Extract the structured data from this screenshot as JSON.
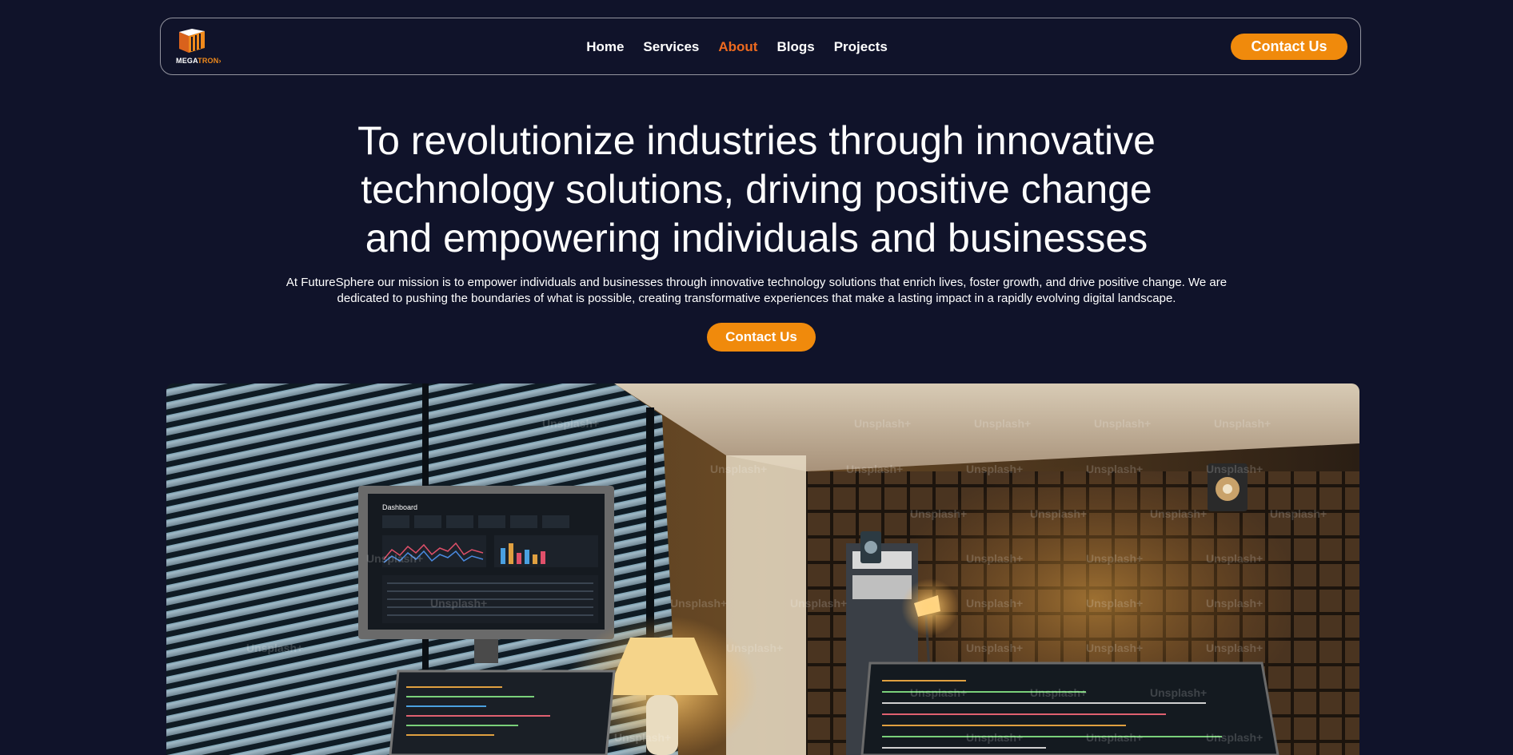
{
  "brand": {
    "logo_text_main": "MEGA",
    "logo_text_accent": "TRON",
    "logo_arrow": "›",
    "icon": "megatron-logo-icon"
  },
  "nav": {
    "items": [
      {
        "label": "Home",
        "active": false
      },
      {
        "label": "Services",
        "active": false
      },
      {
        "label": "About",
        "active": true
      },
      {
        "label": "Blogs",
        "active": false
      },
      {
        "label": "Projects",
        "active": false
      }
    ],
    "contact_label": "Contact Us"
  },
  "hero": {
    "title_line1": "To revolutionize industries through innovative",
    "title_line2": "technology solutions, driving positive change",
    "title_line3": "and empowering individuals and businesses",
    "subtitle_line1": "At FutureSphere our mission is to empower individuals and businesses through innovative technology solutions that enrich lives, foster growth, and drive positive change. We are",
    "subtitle_line2": "dedicated to pushing the boundaries of what is possible, creating transformative experiences that make a lasting impact in a rapidly evolving digital landscape.",
    "contact_label": "Contact Us"
  },
  "image": {
    "watermark": "Unsplash+",
    "monitor_title": "Dashboard"
  },
  "colors": {
    "background": "#10132a",
    "accent": "#f08a0c",
    "active_nav": "#ee6a1f"
  }
}
